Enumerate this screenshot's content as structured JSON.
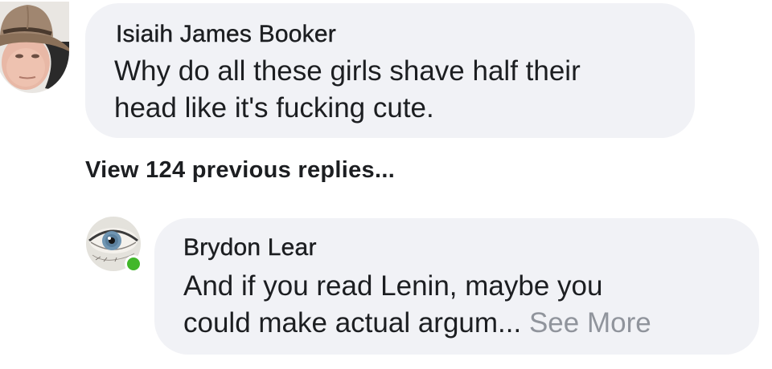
{
  "comment": {
    "author": "Isiaih James Booker",
    "lines": [
      "Why do all these girls shave half their",
      "head like it's fucking cute."
    ],
    "avatar_icon": "cowboy-hat-man-photo"
  },
  "view_replies_label": "View 124 previous replies...",
  "reply": {
    "author": "Brydon Lear",
    "lines": [
      "And if you read Lenin, maybe you",
      "could make actual argum..."
    ],
    "see_more_label": "See More",
    "avatar_icon": "eye-photo",
    "online": true
  },
  "colors": {
    "bubble": "#f1f2f6",
    "text": "#1c1e21",
    "muted": "#90949c",
    "online": "#42b72a"
  }
}
